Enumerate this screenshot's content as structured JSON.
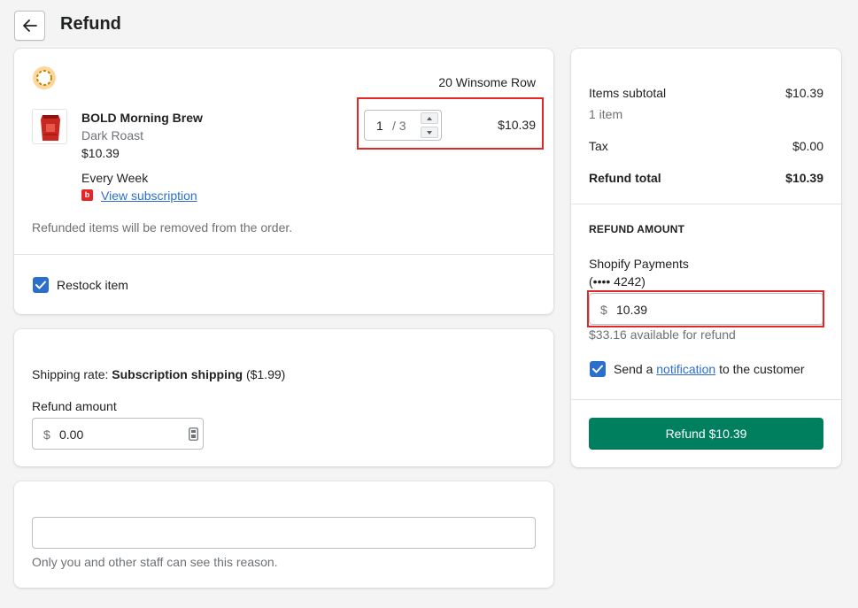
{
  "header": {
    "title": "Refund"
  },
  "items_card": {
    "location": "20 Winsome Row",
    "product": {
      "name": "BOLD Morning Brew",
      "variant": "Dark Roast",
      "price": "$10.39",
      "frequency": "Every Week",
      "subscription_link": "View subscription",
      "quantity": "1",
      "quantity_max": "/ 3",
      "line_total": "$10.39"
    },
    "note": "Refunded items will be removed from the order.",
    "restock_label": "Restock item"
  },
  "shipping_card": {
    "rate_prefix": "Shipping rate: ",
    "rate_name": "Subscription shipping",
    "rate_price": "($1.99)",
    "refund_label": "Refund amount",
    "currency": "$",
    "refund_value": "0.00"
  },
  "reason_card": {
    "reason_value": "",
    "help_text": "Only you and other staff can see this reason."
  },
  "summary": {
    "subtotal_label": "Items subtotal",
    "subtotal_value": "$10.39",
    "item_count": "1 item",
    "tax_label": "Tax",
    "tax_value": "$0.00",
    "total_label": "Refund total",
    "total_value": "$10.39",
    "refund_amount_heading": "REFUND AMOUNT",
    "payment_method": "Shopify Payments",
    "card_mask": "(•••• 4242)",
    "currency": "$",
    "amount_value": "10.39",
    "available": "$33.16 available for refund",
    "notify_prefix": "Send a ",
    "notify_link": "notification",
    "notify_suffix": " to the customer",
    "refund_button": "Refund $10.39"
  },
  "colors": {
    "primary": "#007f5f",
    "accent": "#2c6ecb",
    "highlight": "#e32626"
  }
}
